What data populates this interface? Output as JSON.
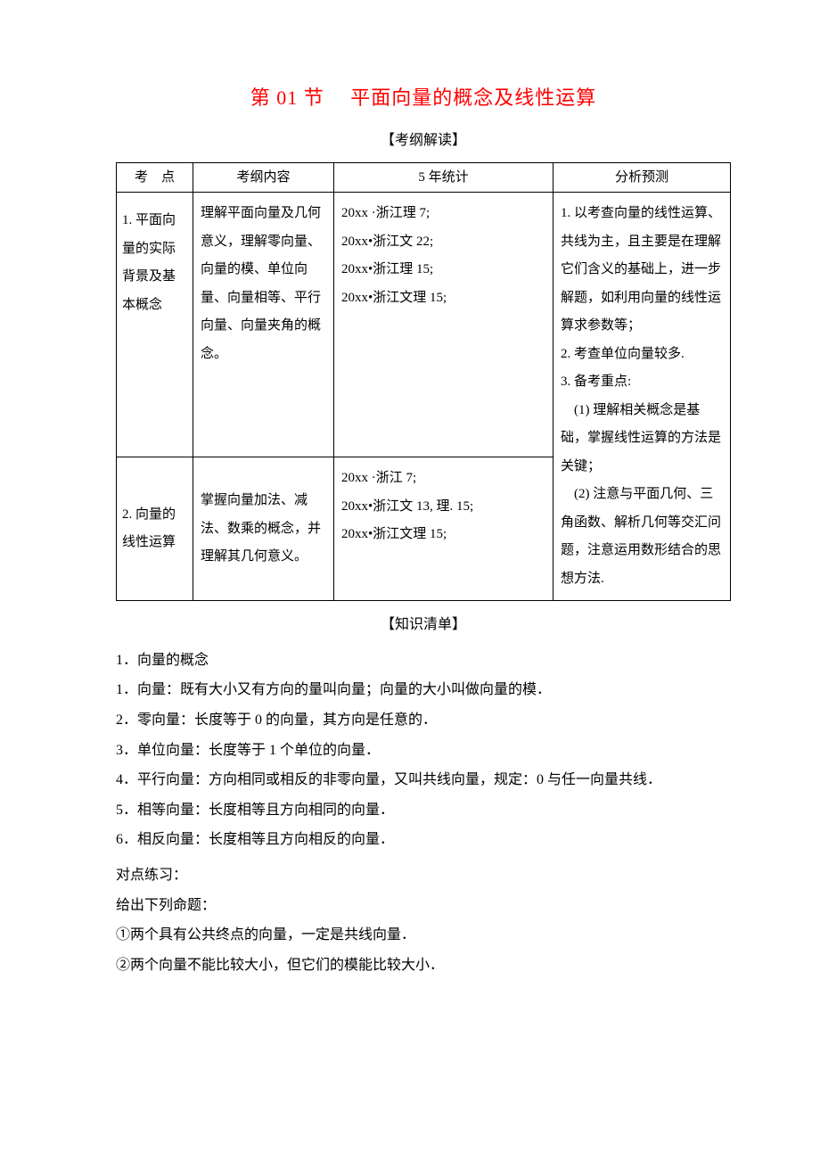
{
  "title": "第 01 节　 平面向量的概念及线性运算",
  "section1_header": "【考纲解读】",
  "table": {
    "headers": {
      "c1": "考　点",
      "c2": "考纲内容",
      "c3": "5 年统计",
      "c4": "分析预测"
    },
    "row1": {
      "topic": "1. 平面向量的实际背景及基本概念",
      "outline": "理解平面向量及几何意义，理解零向量、向量的模、单位向量、向量相等、平行向量、向量夹角的概念。",
      "stats1": "20xx ·浙江理 7;",
      "stats2": "20xx•浙江文 22;",
      "stats3": "20xx•浙江理 15;",
      "stats4": "20xx•浙江文理 15;"
    },
    "row2": {
      "topic": "2. 向量的线性运算",
      "outline": "掌握向量加法、减法、数乘的概念，并理解其几何意义。",
      "stats1": "20xx ·浙江 7;",
      "stats2": "20xx•浙江文 13, 理. 15;",
      "stats3": "20xx•浙江文理 15;"
    },
    "analysis": {
      "p1": "1. 以考查向量的线性运算、共线为主，且主要是在理解它们含义的基础上，进一步解题，如利用向量的线性运算求参数等；",
      "p2": "2. 考查单位向量较多.",
      "p3": "3. 备考重点:",
      "p4": "　(1) 理解相关概念是基础，掌握线性运算的方法是关键；",
      "p5": "　(2) 注意与平面几何、三角函数、解析几何等交汇问题，注意运用数形结合的思想方法."
    }
  },
  "section2_header": "【知识清单】",
  "knowledge": {
    "heading": "1．向量的概念",
    "item1": "1．向量：既有大小又有方向的量叫向量；向量的大小叫做向量的模．",
    "item2": "2．零向量：长度等于 0 的向量，其方向是任意的．",
    "item3": "3．单位向量：长度等于 1 个单位的向量．",
    "item4": "4．平行向量：方向相同或相反的非零向量，又叫共线向量，规定：0 与任一向量共线．",
    "item5": "5．相等向量：长度相等且方向相同的向量．",
    "item6": "6．相反向量：长度相等且方向相反的向量．"
  },
  "practice": {
    "heading": "对点练习：",
    "intro": "给出下列命题：",
    "stmt1": "①两个具有公共终点的向量，一定是共线向量．",
    "stmt2": "②两个向量不能比较大小，但它们的模能比较大小．"
  }
}
